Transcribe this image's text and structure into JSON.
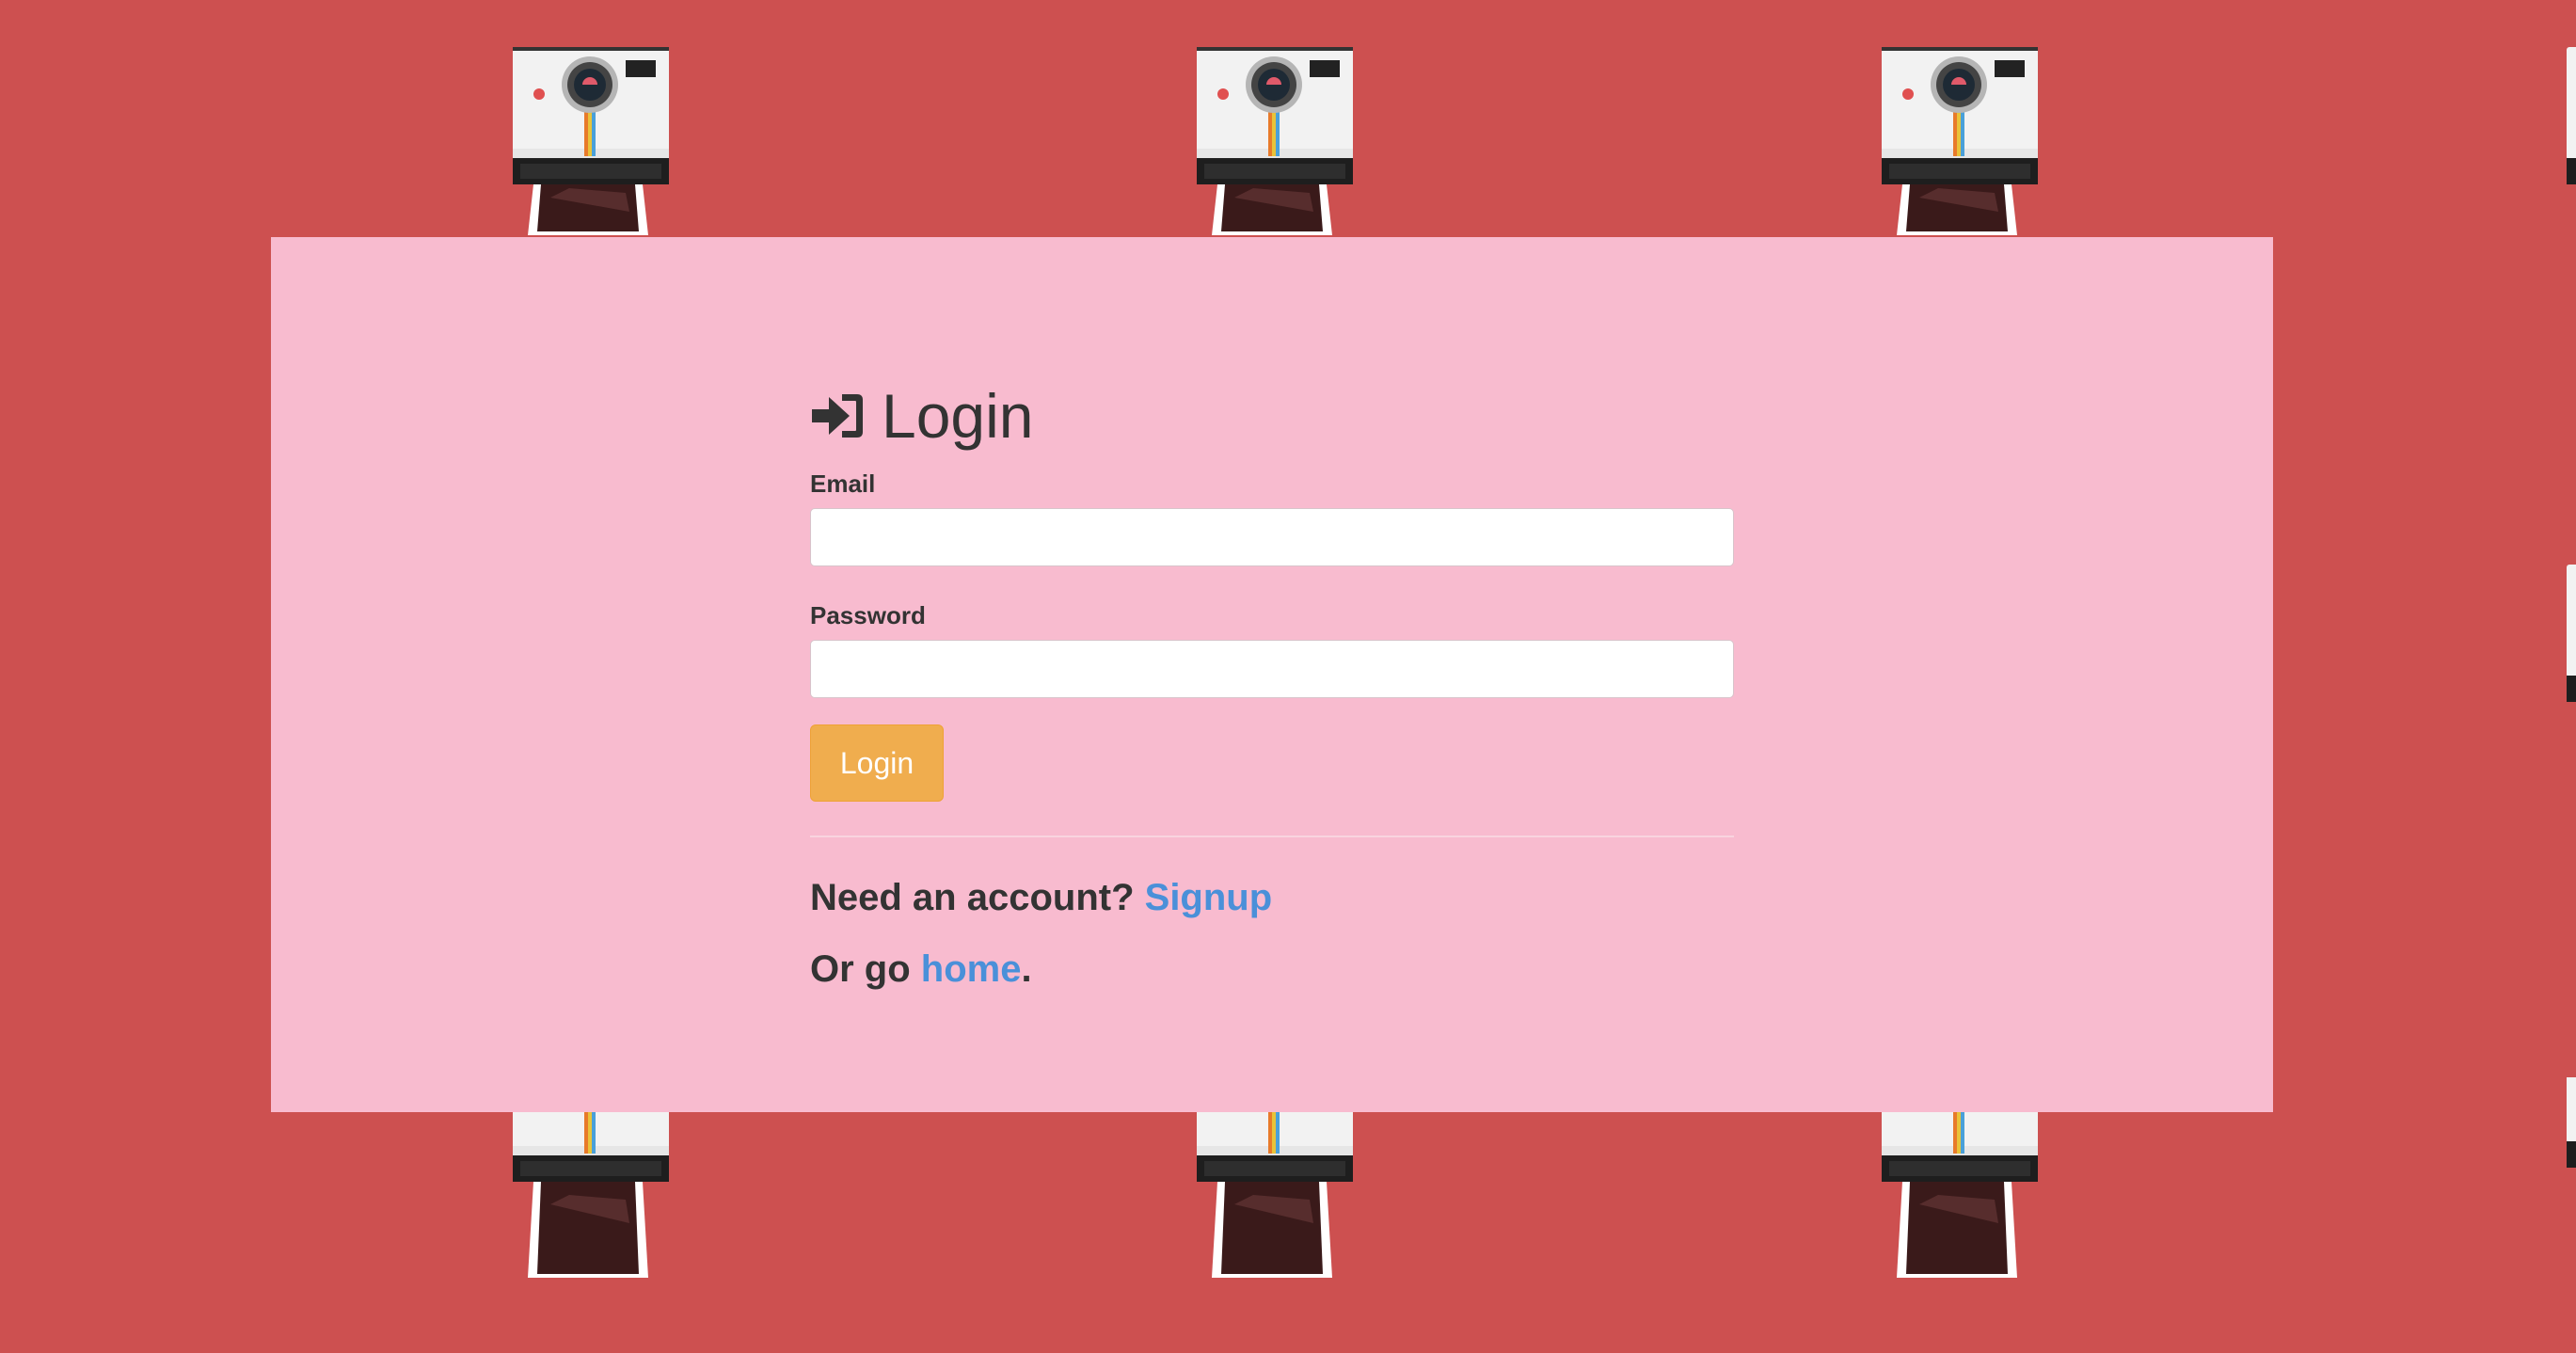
{
  "background": {
    "color": "#cd5050",
    "pattern_icon": "instant-camera-icon"
  },
  "panel": {
    "color": "#f8bbcf"
  },
  "login": {
    "heading_icon": "sign-in-icon",
    "heading": "Login",
    "email_label": "Email",
    "email_value": "",
    "password_label": "Password",
    "password_value": "",
    "submit_label": "Login",
    "submit_color": "#f0ad4e"
  },
  "footer": {
    "account_prefix": "Need an account?",
    "signup_link": "Signup",
    "home_prefix": "Or go",
    "home_link": "home",
    "home_suffix": ".",
    "link_color": "#4a90d9"
  }
}
